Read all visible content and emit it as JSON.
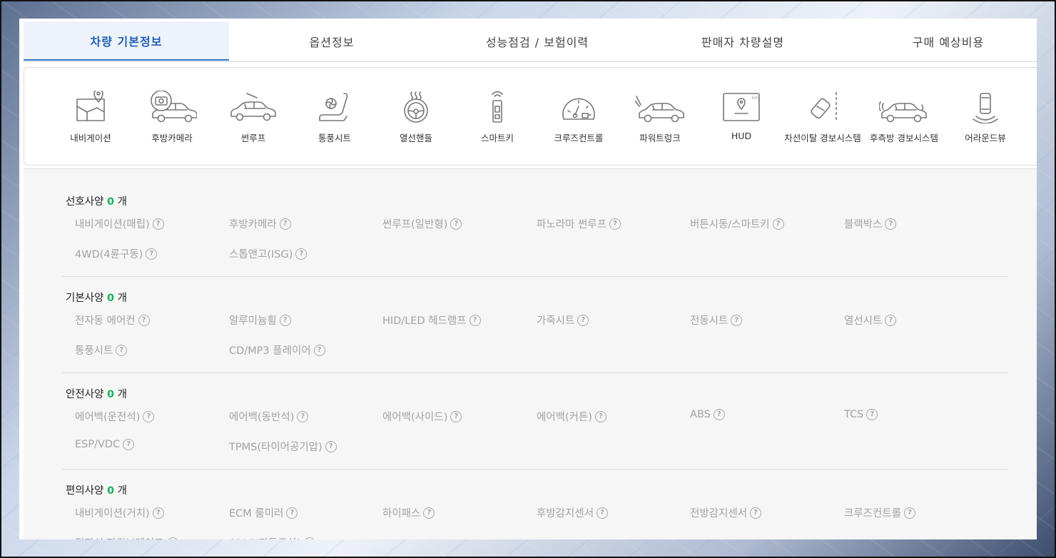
{
  "tabs": [
    {
      "label": "차량 기본정보",
      "active": true
    },
    {
      "label": "옵션정보",
      "active": false
    },
    {
      "label": "성능점검 / 보험이력",
      "active": false
    },
    {
      "label": "판매자 차량설명",
      "active": false
    },
    {
      "label": "구매 예상비용",
      "active": false
    }
  ],
  "key_options": [
    {
      "label": "내비게이션",
      "icon": "navigation-icon"
    },
    {
      "label": "후방카메라",
      "icon": "rear-camera-icon"
    },
    {
      "label": "썬루프",
      "icon": "sunroof-icon"
    },
    {
      "label": "통풍시트",
      "icon": "ventilated-seat-icon"
    },
    {
      "label": "열선핸들",
      "icon": "heated-steering-icon"
    },
    {
      "label": "스마트키",
      "icon": "smart-key-icon"
    },
    {
      "label": "크루즈컨트롤",
      "icon": "cruise-control-icon"
    },
    {
      "label": "파워트렁크",
      "icon": "power-trunk-icon"
    },
    {
      "label": "HUD",
      "icon": "hud-icon"
    },
    {
      "label": "차선이탈 경보시스템",
      "icon": "lane-departure-icon"
    },
    {
      "label": "후측방 경보시스템",
      "icon": "blind-spot-icon"
    },
    {
      "label": "어라운드뷰",
      "icon": "around-view-icon"
    }
  ],
  "sections": [
    {
      "title": "선호사양",
      "count": "0",
      "unit": "개",
      "items": [
        "내비게이션(매립)",
        "후방카메라",
        "썬루프(일반형)",
        "파노라마 썬루프",
        "버튼시동/스마트키",
        "블랙박스",
        "4WD(4륜구동)",
        "스톱앤고(ISG)"
      ]
    },
    {
      "title": "기본사양",
      "count": "0",
      "unit": "개",
      "items": [
        "전자동 에어컨",
        "알루미늄휠",
        "HID/LED 헤드램프",
        "가죽시트",
        "전동시트",
        "열선시트",
        "통풍시트",
        "CD/MP3 플레이어"
      ]
    },
    {
      "title": "안전사양",
      "count": "0",
      "unit": "개",
      "items": [
        "에어백(운전석)",
        "에어백(동반석)",
        "에어백(사이드)",
        "에어백(커튼)",
        "ABS",
        "TCS",
        "ESP/VDC",
        "TPMS(타이어공기압)"
      ]
    },
    {
      "title": "편의사양",
      "count": "0",
      "unit": "개",
      "items": [
        "내비게이션(거치)",
        "ECM 룸미러",
        "하이패스",
        "후방감지센서",
        "전방감지센서",
        "크루즈컨트롤",
        "전자식 파킹브레이크",
        "SPAS(자동주차)"
      ]
    }
  ],
  "help_glyph": "?",
  "colors": {
    "active_tab": "#1f5fb4",
    "count": "#19b35b",
    "item": "#a2a2a2"
  }
}
